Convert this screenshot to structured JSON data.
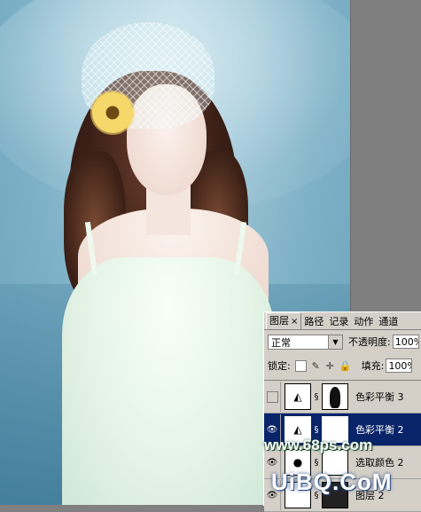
{
  "panel": {
    "tabs": [
      {
        "label": "图层",
        "close": "×"
      },
      {
        "label": "路径"
      },
      {
        "label": "记录"
      },
      {
        "label": "动作"
      },
      {
        "label": "通道"
      }
    ],
    "blend_mode": "正常",
    "opacity_label": "不透明度:",
    "opacity_value": "100%",
    "lock_label": "锁定:",
    "fill_label": "填充:",
    "fill_value": "100%",
    "layers": [
      {
        "name": "色彩平衡 3",
        "visible": false,
        "selected": false
      },
      {
        "name": "色彩平衡 2",
        "visible": true,
        "selected": true
      },
      {
        "name": "选取颜色 2",
        "visible": true,
        "selected": false
      },
      {
        "name": "图层 2",
        "visible": true,
        "selected": false
      }
    ]
  },
  "watermarks": {
    "site1": "www.68ps.com",
    "site2": "UiBQ.CoM"
  },
  "icons": {
    "eye": "eye-icon",
    "link": "chain-link-icon",
    "adjustment": "color-balance-adjustment-icon",
    "dropdown": "chevron-down-icon"
  }
}
